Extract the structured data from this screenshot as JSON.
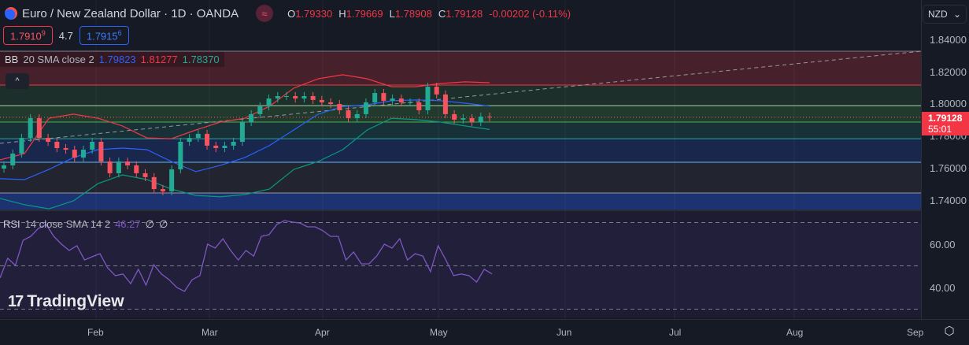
{
  "header": {
    "title": "Euro / New Zealand Dollar · 1D · OANDA",
    "indicator_badge": "≈",
    "open_label": "O",
    "open": "1.79330",
    "high_label": "H",
    "high": "1.79669",
    "low_label": "L",
    "low": "1.78908",
    "close_label": "C",
    "close": "1.79128",
    "change": "-0.00202 (-0.11%)"
  },
  "quote": {
    "sell": "1.7910",
    "sell_sup": "9",
    "spread": "4.7",
    "buy": "1.7915",
    "buy_sup": "6"
  },
  "bb": {
    "label": "BB",
    "params": "20 SMA close 2",
    "basis": "1.79823",
    "upper": "1.81277",
    "lower": "1.78370"
  },
  "collapse_icon": "^",
  "rsi": {
    "label": "RSI",
    "params": "14 close SMA 14 2",
    "value": "46.27",
    "extra1": "∅",
    "extra2": "∅"
  },
  "logo": "TradingView",
  "currency": "NZD",
  "price_ticks": [
    "1.84000",
    "1.82000",
    "1.80000",
    "1.78000",
    "1.76000",
    "1.74000"
  ],
  "rsi_ticks": [
    "60.00",
    "40.00"
  ],
  "last_price": "1.79128",
  "countdown": "55:01",
  "months": [
    "Feb",
    "Mar",
    "Apr",
    "May",
    "Jun",
    "Jul",
    "Aug",
    "Sep"
  ],
  "colors": {
    "up": "#22ab94",
    "down": "#f7525f",
    "bb_basis": "#2962ff",
    "bb_upper": "#f23645",
    "bb_lower": "#089981",
    "rsi": "#7e57c2"
  },
  "chart_data": {
    "type": "candlestick",
    "title": "Euro / New Zealand Dollar · 1D · OANDA",
    "ylim": [
      1.735,
      1.846
    ],
    "closes": [
      1.7615,
      1.7688,
      1.7785,
      1.7907,
      1.7785,
      1.7761,
      1.7722,
      1.7712,
      1.7663,
      1.7712,
      1.7761,
      1.7639,
      1.7566,
      1.7639,
      1.7615,
      1.7566,
      1.7542,
      1.7468,
      1.7454,
      1.759,
      1.7761,
      1.7785,
      1.781,
      1.7737,
      1.7722,
      1.7737,
      1.7761,
      1.7883,
      1.7932,
      1.798,
      1.8029,
      1.8044,
      1.8044,
      1.8029,
      1.8044,
      1.802,
      1.8005,
      1.7995,
      1.7956,
      1.7907,
      1.7932,
      1.8005,
      1.8063,
      1.8015,
      1.8029,
      1.8005,
      1.8005,
      1.7956,
      1.8102,
      1.8054,
      1.7932,
      1.7898,
      1.7907,
      1.7883,
      1.7917,
      1.7913
    ],
    "bb_upper": [
      1.7649,
      1.7688,
      1.7907,
      1.7932,
      1.7907,
      1.7859,
      1.7785,
      1.778,
      1.7834,
      1.7883,
      1.7907,
      1.798,
      1.8093,
      1.8151,
      1.8176,
      1.8151,
      1.8102,
      1.8102,
      1.8122,
      1.8132,
      1.8127
    ],
    "bb_basis": [
      1.7532,
      1.7527,
      1.759,
      1.7663,
      1.7712,
      1.7722,
      1.7712,
      1.7639,
      1.7576,
      1.7615,
      1.7663,
      1.7737,
      1.7834,
      1.7932,
      1.798,
      1.799,
      1.8015,
      1.802,
      1.8015,
      1.8,
      1.7982
    ],
    "bb_lower": [
      1.741,
      1.7371,
      1.7346,
      1.7395,
      1.7502,
      1.7556,
      1.7527,
      1.7468,
      1.7429,
      1.742,
      1.7434,
      1.7468,
      1.759,
      1.7639,
      1.7712,
      1.7834,
      1.7907,
      1.7898,
      1.7883,
      1.7859,
      1.7837
    ],
    "levels": [
      {
        "price": 1.8112,
        "color": "#f23645"
      },
      {
        "price": 1.7985,
        "color": "#a5d6a7"
      },
      {
        "price": 1.7883,
        "color": "#4caf50"
      },
      {
        "price": 1.778,
        "color": "#26a69a"
      },
      {
        "price": 1.7634,
        "color": "#64b5f6"
      },
      {
        "price": 1.7444,
        "color": "#9598a1"
      }
    ],
    "trendline": [
      1.7751,
      1.8322
    ],
    "rsi": {
      "ylim": [
        24,
        76
      ],
      "bands": [
        70,
        50,
        30
      ],
      "values": [
        44.4,
        53.5,
        50.2,
        61.8,
        63.6,
        67.3,
        69.1,
        63.6,
        60,
        57.1,
        59.3,
        52.7,
        54.2,
        55.6,
        49.1,
        45.5,
        46.2,
        41.8,
        48.4,
        41.1,
        50.5,
        46.2,
        43.6,
        40,
        38.2,
        43.6,
        45.5,
        60,
        58.2,
        62.5,
        57.1,
        52.7,
        57.1,
        54.5,
        63.6,
        64.4,
        69.1,
        70.9,
        70.2,
        69.8,
        68,
        68,
        66.2,
        63.6,
        63.6,
        52.7,
        56.4,
        50.9,
        50.9,
        54.5,
        60,
        58.2,
        62.5,
        52.7,
        55.6,
        54.5,
        47.3,
        59.3,
        52.7,
        45.5,
        46.2,
        45.5,
        42.5,
        48.4,
        46.3
      ]
    }
  }
}
